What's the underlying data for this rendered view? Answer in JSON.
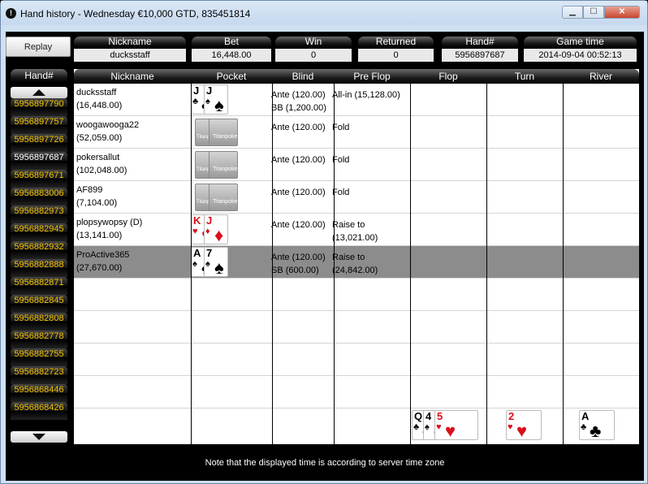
{
  "window": {
    "title": "Hand history - Wednesday €10,000 GTD, 835451814",
    "app_icon": "!"
  },
  "toolbar": {
    "replay_label": "Replay"
  },
  "summary": {
    "headers": [
      "Nickname",
      "Bet",
      "Win",
      "Returned",
      "Hand#",
      "Game time"
    ],
    "values": [
      "ducksstaff",
      "16,448.00",
      "0",
      "0",
      "5956897687",
      "2014-09-04 00:52:13"
    ]
  },
  "hand_list": {
    "header": "Hand#",
    "items": [
      "5956897790",
      "5956897757",
      "5956897726",
      "5956897687",
      "5956897671",
      "5956883006",
      "5956882973",
      "5956882945",
      "5956882932",
      "5956882888",
      "5956882871",
      "5956882845",
      "5956882808",
      "5956882778",
      "5956882755",
      "5956882723",
      "5956868446",
      "5956868426"
    ],
    "selected_index": 3
  },
  "table": {
    "headers": [
      "Nickname",
      "Pocket",
      "Blind",
      "Pre Flop",
      "Flop",
      "Turn",
      "River"
    ],
    "rows": [
      {
        "name": "ducksstaff",
        "stack": "(16,448.00)",
        "blind1": "Ante (120.00)",
        "blind2": "BB (1,200.00)",
        "pre1": "All-in (15,128.00)",
        "pre2": "",
        "pocket": [
          {
            "rank": "J",
            "suit": "♣",
            "color": "#000000"
          },
          {
            "rank": "J",
            "suit": "♠",
            "color": "#000000"
          }
        ]
      },
      {
        "name": "woogawooga22",
        "stack": "(52,059.00)",
        "blind1": "Ante (120.00)",
        "blind2": "",
        "pre1": "Fold",
        "pre2": "",
        "pocket": "back"
      },
      {
        "name": "pokersallut",
        "stack": "(102,048.00)",
        "blind1": "Ante (120.00)",
        "blind2": "",
        "pre1": "Fold",
        "pre2": "",
        "pocket": "back"
      },
      {
        "name": "AF899",
        "stack": "(7,104.00)",
        "blind1": "Ante (120.00)",
        "blind2": "",
        "pre1": "Fold",
        "pre2": "",
        "pocket": "back"
      },
      {
        "name": "plopsywopsy (D)",
        "stack": "(13,141.00)",
        "blind1": "Ante (120.00)",
        "blind2": "",
        "pre1": "Raise to",
        "pre2": "(13,021.00)",
        "pocket": [
          {
            "rank": "K",
            "suit": "♥",
            "color": "#d8101a"
          },
          {
            "rank": "J",
            "suit": "♦",
            "color": "#d8101a"
          }
        ]
      },
      {
        "name": "ProActive365",
        "stack": "(27,670.00)",
        "blind1": "Ante (120.00)",
        "blind2": "SB (600.00)",
        "pre1": "Raise to",
        "pre2": "(24,842.00)",
        "pocket": [
          {
            "rank": "A",
            "suit": "♠",
            "color": "#000000"
          },
          {
            "rank": "7",
            "suit": "♠",
            "color": "#000000"
          }
        ],
        "highlight": true
      }
    ],
    "card_back_label": "Titanpoker",
    "board": {
      "flop": [
        {
          "rank": "Q",
          "suit": "♣",
          "color": "#000000"
        },
        {
          "rank": "4",
          "suit": "♠",
          "color": "#000000"
        },
        {
          "rank": "5",
          "suit": "♥",
          "color": "#d8101a"
        }
      ],
      "turn": [
        {
          "rank": "2",
          "suit": "♥",
          "color": "#d8101a"
        }
      ],
      "river": [
        {
          "rank": "A",
          "suit": "♣",
          "color": "#000000"
        }
      ]
    }
  },
  "footer": {
    "note": "Note that the displayed time is according to server time zone"
  }
}
